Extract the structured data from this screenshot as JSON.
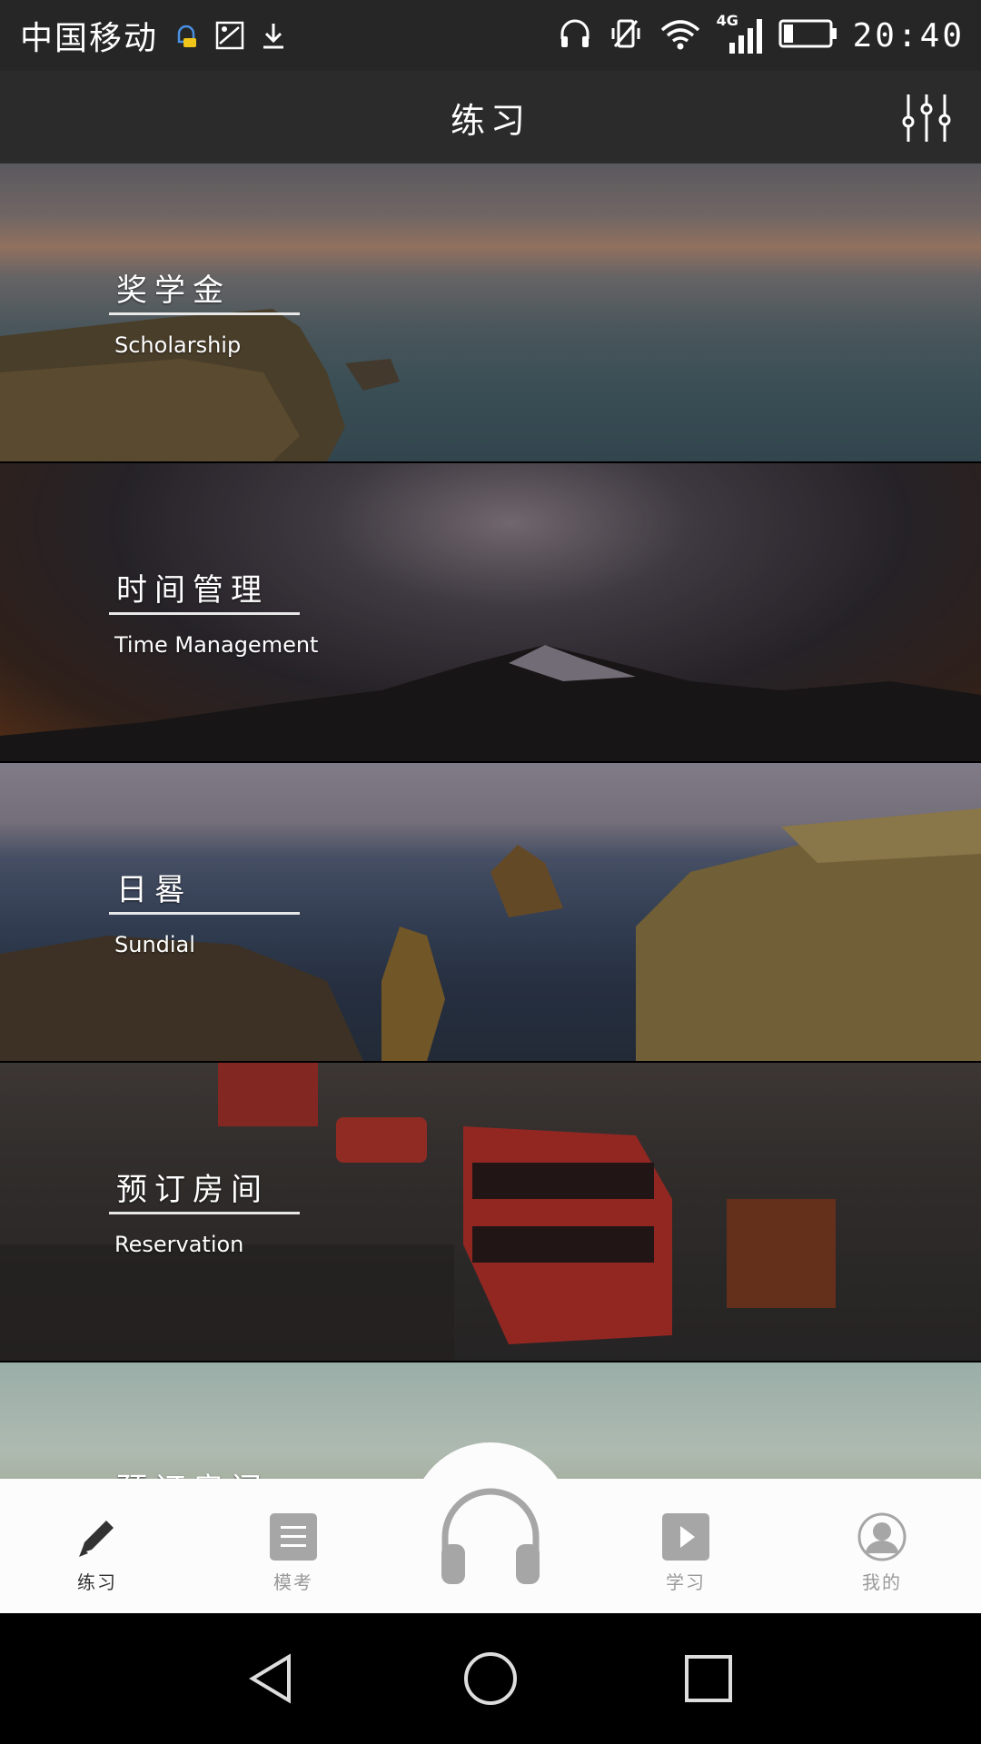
{
  "status_bar": {
    "carrier": "中国移动",
    "network": "4G",
    "time": "20:40"
  },
  "header": {
    "title": "练习"
  },
  "cards": [
    {
      "title": "奖学金",
      "subtitle": "Scholarship"
    },
    {
      "title": "时间管理",
      "subtitle": "Time Management"
    },
    {
      "title": "日晷",
      "subtitle": "Sundial"
    },
    {
      "title": "预订房间",
      "subtitle": "Reservation"
    },
    {
      "title": "预订房间",
      "subtitle": ""
    }
  ],
  "bottom_nav": {
    "items": [
      {
        "label": "练习",
        "icon": "pencil-icon",
        "active": true
      },
      {
        "label": "模考",
        "icon": "list-icon",
        "active": false
      },
      {
        "label": "",
        "icon": "headphones-icon",
        "active": false
      },
      {
        "label": "学习",
        "icon": "play-icon",
        "active": false
      },
      {
        "label": "我的",
        "icon": "person-icon",
        "active": false
      }
    ]
  },
  "colors": {
    "status_bar": "#262626",
    "title_bar": "#2b2b2b",
    "nav_background": "#fcfcfc",
    "nav_active": "#333333",
    "nav_inactive": "#9a9a9a"
  }
}
